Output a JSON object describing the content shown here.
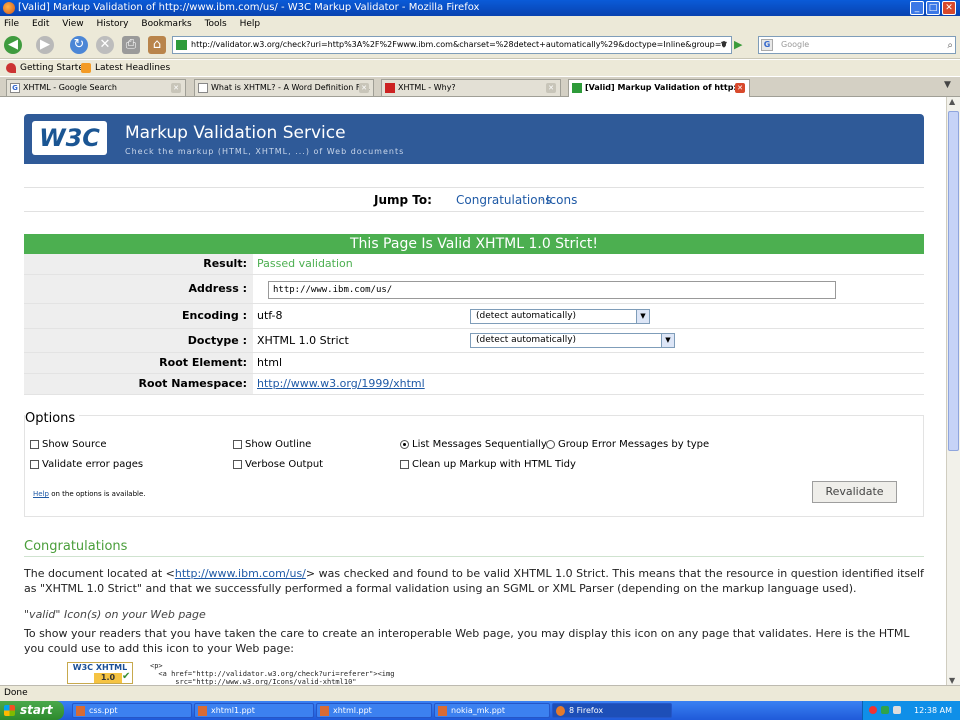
{
  "window": {
    "title": "[Valid] Markup Validation of http://www.ibm.com/us/ - W3C Markup Validator - Mozilla Firefox"
  },
  "menu": [
    "File",
    "Edit",
    "View",
    "History",
    "Bookmarks",
    "Tools",
    "Help"
  ],
  "nav": {
    "url": "http://validator.w3.org/check?uri=http%3A%2F%2Fwww.ibm.com&charset=%28detect+automatically%29&doctype=Inline&group=0",
    "search_placeholder": "Google",
    "search_engine_badge": "G"
  },
  "bookmarks": [
    "Getting Started",
    "Latest Headlines"
  ],
  "tabs": [
    {
      "label": "XHTML - Google Search",
      "active": false
    },
    {
      "label": "What is XHTML? - A Word Definition Fr...",
      "active": false
    },
    {
      "label": "XHTML - Why?",
      "active": false
    },
    {
      "label": "[Valid] Markup Validation of http:...",
      "active": true
    }
  ],
  "page": {
    "logo_text": "W3C",
    "service_title": "Markup Validation Service",
    "service_subtitle": "Check the markup (HTML, XHTML, ...) of Web documents",
    "jump_label": "Jump To:",
    "jump_links": [
      "Congratulations",
      "Icons"
    ],
    "jump_sep": "·",
    "valid_banner": "This Page Is Valid XHTML 1.0 Strict!",
    "rows": {
      "result": {
        "label": "Result:",
        "value": "Passed validation"
      },
      "address": {
        "label": "Address :",
        "value": "http://www.ibm.com/us/"
      },
      "encoding": {
        "label": "Encoding :",
        "value": "utf-8",
        "select": "(detect automatically)"
      },
      "doctype": {
        "label": "Doctype :",
        "value": "XHTML 1.0 Strict",
        "select": "(detect automatically)"
      },
      "root_element": {
        "label": "Root Element:",
        "value": "html"
      },
      "root_namespace": {
        "label": "Root Namespace:",
        "value": "http://www.w3.org/1999/xhtml"
      }
    },
    "options": {
      "heading": "Options",
      "show_source": "Show Source",
      "show_outline": "Show Outline",
      "list_sequential": "List Messages Sequentially",
      "group_errors": "Group Error Messages by type",
      "validate_error_pages": "Validate error pages",
      "verbose_output": "Verbose Output",
      "cleanup_tidy": "Clean up Markup with HTML Tidy",
      "help_link": "Help",
      "help_text": " on the options is available.",
      "revalidate": "Revalidate"
    },
    "congrats": {
      "heading": "Congratulations",
      "p1_a": "The document located at <",
      "p1_link": "http://www.ibm.com/us/",
      "p1_b": "> was checked and found to be valid XHTML 1.0 Strict. This means that the resource in question identified itself as \"XHTML 1.0 Strict\" and that we successfully performed a formal validation using an SGML or XML Parser (depending on the markup language used).",
      "icon_heading": "\"valid\" Icon(s) on your Web page",
      "p2": "To show your readers that you have taken the care to create an interoperable Web page, you may display this icon on any page that validates. Here is the HTML you could use to add this icon to your Web page:",
      "badge_top": "W3C XHTML",
      "badge_ver": "1.0",
      "code": "<p>\n  <a href=\"http://validator.w3.org/check?uri=referer\"><img\n      src=\"http://www.w3.org/Icons/valid-xhtml10\""
    }
  },
  "status": "Done",
  "taskbar": {
    "start": "start",
    "items": [
      "css.ppt",
      "xhtml1.ppt",
      "xhtml.ppt",
      "nokia_mk.ppt",
      "8 Firefox"
    ],
    "clock": "12:38 AM"
  }
}
